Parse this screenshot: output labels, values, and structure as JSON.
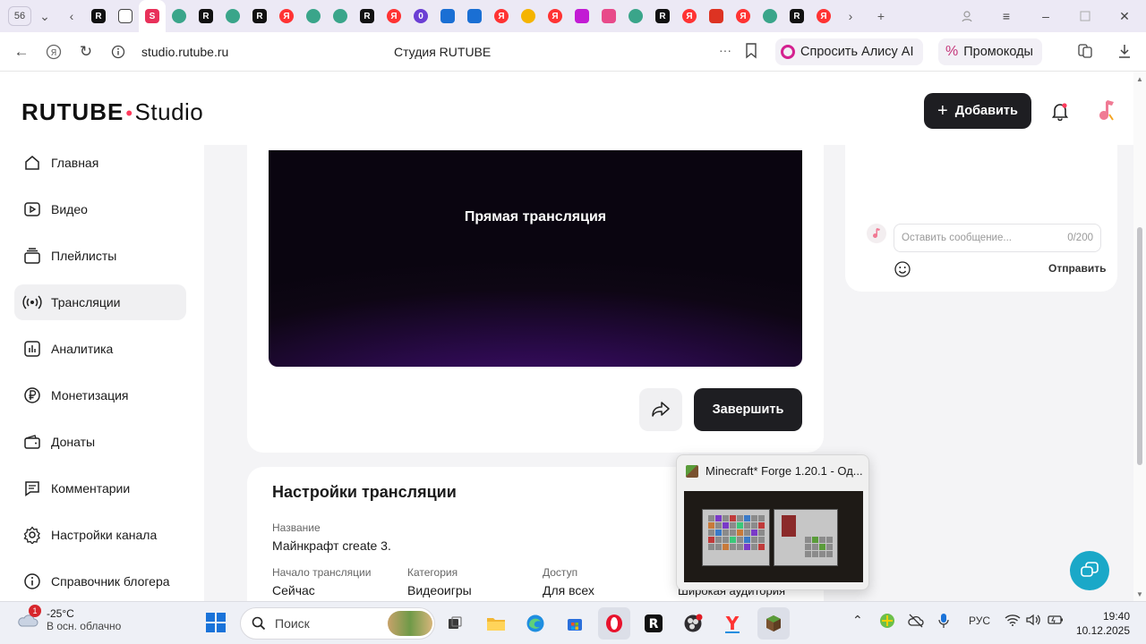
{
  "browser": {
    "tab_count": "56",
    "url": "studio.rutube.ru",
    "page_title": "Студия RUTUBE",
    "alice_label": "Спросить Алису AI",
    "promo_label": "Промокоды",
    "more_label": "···"
  },
  "header": {
    "logo_brand": "RUTUBE",
    "logo_suffix": "Studio",
    "add_label": "Добавить"
  },
  "sidebar": {
    "items": [
      {
        "label": "Главная",
        "icon": "home-icon"
      },
      {
        "label": "Видео",
        "icon": "video-icon"
      },
      {
        "label": "Плейлисты",
        "icon": "playlist-icon"
      },
      {
        "label": "Трансляции",
        "icon": "broadcast-icon",
        "active": true
      },
      {
        "label": "Аналитика",
        "icon": "analytics-icon"
      },
      {
        "label": "Монетизация",
        "icon": "ruble-icon"
      },
      {
        "label": "Донаты",
        "icon": "wallet-icon"
      },
      {
        "label": "Комментарии",
        "icon": "comment-icon"
      },
      {
        "label": "Настройки канала",
        "icon": "gear-icon"
      },
      {
        "label": "Справочник блогера",
        "icon": "info-icon"
      }
    ]
  },
  "player": {
    "label": "Прямая трансляция",
    "finish_label": "Завершить"
  },
  "chat": {
    "placeholder": "Оставить сообщение...",
    "counter": "0/200",
    "send_label": "Отправить"
  },
  "settings": {
    "title": "Настройки трансляции",
    "name_label": "Название",
    "name_value": "Майнкрафт create 3.",
    "start_label": "Начало трансляции",
    "start_value": "Сейчас",
    "category_label": "Категория",
    "category_value": "Видеоигры",
    "access_label": "Доступ",
    "access_value": "Для всех",
    "audience_value": "Широкая аудитория"
  },
  "preview": {
    "title": "Minecraft* Forge 1.20.1 - Од..."
  },
  "taskbar": {
    "weather_badge": "1",
    "weather_temp": "-25°C",
    "weather_desc": "В осн. облачно",
    "search_placeholder": "Поиск",
    "lang": "РУС",
    "time": "19:40",
    "date": "10.12.2025"
  },
  "colors": {
    "accent_dark": "#1e1e22",
    "logo_dot": "#ff3a5c",
    "support_button": "#1aa8c8",
    "player_glow": "#4a0f7a"
  }
}
